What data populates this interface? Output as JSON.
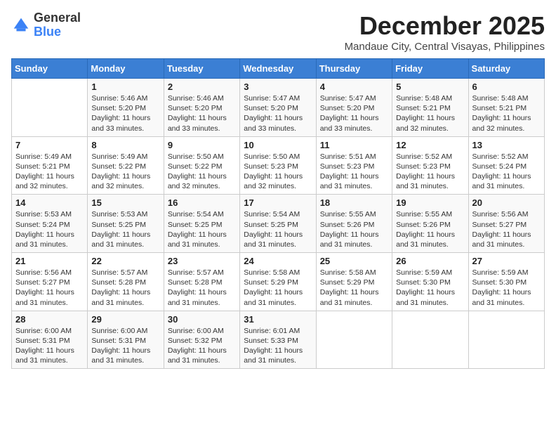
{
  "logo": {
    "general": "General",
    "blue": "Blue"
  },
  "title": "December 2025",
  "location": "Mandaue City, Central Visayas, Philippines",
  "weekdays": [
    "Sunday",
    "Monday",
    "Tuesday",
    "Wednesday",
    "Thursday",
    "Friday",
    "Saturday"
  ],
  "weeks": [
    [
      {
        "day": "",
        "info": ""
      },
      {
        "day": "1",
        "info": "Sunrise: 5:46 AM\nSunset: 5:20 PM\nDaylight: 11 hours\nand 33 minutes."
      },
      {
        "day": "2",
        "info": "Sunrise: 5:46 AM\nSunset: 5:20 PM\nDaylight: 11 hours\nand 33 minutes."
      },
      {
        "day": "3",
        "info": "Sunrise: 5:47 AM\nSunset: 5:20 PM\nDaylight: 11 hours\nand 33 minutes."
      },
      {
        "day": "4",
        "info": "Sunrise: 5:47 AM\nSunset: 5:20 PM\nDaylight: 11 hours\nand 33 minutes."
      },
      {
        "day": "5",
        "info": "Sunrise: 5:48 AM\nSunset: 5:21 PM\nDaylight: 11 hours\nand 32 minutes."
      },
      {
        "day": "6",
        "info": "Sunrise: 5:48 AM\nSunset: 5:21 PM\nDaylight: 11 hours\nand 32 minutes."
      }
    ],
    [
      {
        "day": "7",
        "info": "Sunrise: 5:49 AM\nSunset: 5:21 PM\nDaylight: 11 hours\nand 32 minutes."
      },
      {
        "day": "8",
        "info": "Sunrise: 5:49 AM\nSunset: 5:22 PM\nDaylight: 11 hours\nand 32 minutes."
      },
      {
        "day": "9",
        "info": "Sunrise: 5:50 AM\nSunset: 5:22 PM\nDaylight: 11 hours\nand 32 minutes."
      },
      {
        "day": "10",
        "info": "Sunrise: 5:50 AM\nSunset: 5:23 PM\nDaylight: 11 hours\nand 32 minutes."
      },
      {
        "day": "11",
        "info": "Sunrise: 5:51 AM\nSunset: 5:23 PM\nDaylight: 11 hours\nand 31 minutes."
      },
      {
        "day": "12",
        "info": "Sunrise: 5:52 AM\nSunset: 5:23 PM\nDaylight: 11 hours\nand 31 minutes."
      },
      {
        "day": "13",
        "info": "Sunrise: 5:52 AM\nSunset: 5:24 PM\nDaylight: 11 hours\nand 31 minutes."
      }
    ],
    [
      {
        "day": "14",
        "info": "Sunrise: 5:53 AM\nSunset: 5:24 PM\nDaylight: 11 hours\nand 31 minutes."
      },
      {
        "day": "15",
        "info": "Sunrise: 5:53 AM\nSunset: 5:25 PM\nDaylight: 11 hours\nand 31 minutes."
      },
      {
        "day": "16",
        "info": "Sunrise: 5:54 AM\nSunset: 5:25 PM\nDaylight: 11 hours\nand 31 minutes."
      },
      {
        "day": "17",
        "info": "Sunrise: 5:54 AM\nSunset: 5:25 PM\nDaylight: 11 hours\nand 31 minutes."
      },
      {
        "day": "18",
        "info": "Sunrise: 5:55 AM\nSunset: 5:26 PM\nDaylight: 11 hours\nand 31 minutes."
      },
      {
        "day": "19",
        "info": "Sunrise: 5:55 AM\nSunset: 5:26 PM\nDaylight: 11 hours\nand 31 minutes."
      },
      {
        "day": "20",
        "info": "Sunrise: 5:56 AM\nSunset: 5:27 PM\nDaylight: 11 hours\nand 31 minutes."
      }
    ],
    [
      {
        "day": "21",
        "info": "Sunrise: 5:56 AM\nSunset: 5:27 PM\nDaylight: 11 hours\nand 31 minutes."
      },
      {
        "day": "22",
        "info": "Sunrise: 5:57 AM\nSunset: 5:28 PM\nDaylight: 11 hours\nand 31 minutes."
      },
      {
        "day": "23",
        "info": "Sunrise: 5:57 AM\nSunset: 5:28 PM\nDaylight: 11 hours\nand 31 minutes."
      },
      {
        "day": "24",
        "info": "Sunrise: 5:58 AM\nSunset: 5:29 PM\nDaylight: 11 hours\nand 31 minutes."
      },
      {
        "day": "25",
        "info": "Sunrise: 5:58 AM\nSunset: 5:29 PM\nDaylight: 11 hours\nand 31 minutes."
      },
      {
        "day": "26",
        "info": "Sunrise: 5:59 AM\nSunset: 5:30 PM\nDaylight: 11 hours\nand 31 minutes."
      },
      {
        "day": "27",
        "info": "Sunrise: 5:59 AM\nSunset: 5:30 PM\nDaylight: 11 hours\nand 31 minutes."
      }
    ],
    [
      {
        "day": "28",
        "info": "Sunrise: 6:00 AM\nSunset: 5:31 PM\nDaylight: 11 hours\nand 31 minutes."
      },
      {
        "day": "29",
        "info": "Sunrise: 6:00 AM\nSunset: 5:31 PM\nDaylight: 11 hours\nand 31 minutes."
      },
      {
        "day": "30",
        "info": "Sunrise: 6:00 AM\nSunset: 5:32 PM\nDaylight: 11 hours\nand 31 minutes."
      },
      {
        "day": "31",
        "info": "Sunrise: 6:01 AM\nSunset: 5:33 PM\nDaylight: 11 hours\nand 31 minutes."
      },
      {
        "day": "",
        "info": ""
      },
      {
        "day": "",
        "info": ""
      },
      {
        "day": "",
        "info": ""
      }
    ]
  ]
}
